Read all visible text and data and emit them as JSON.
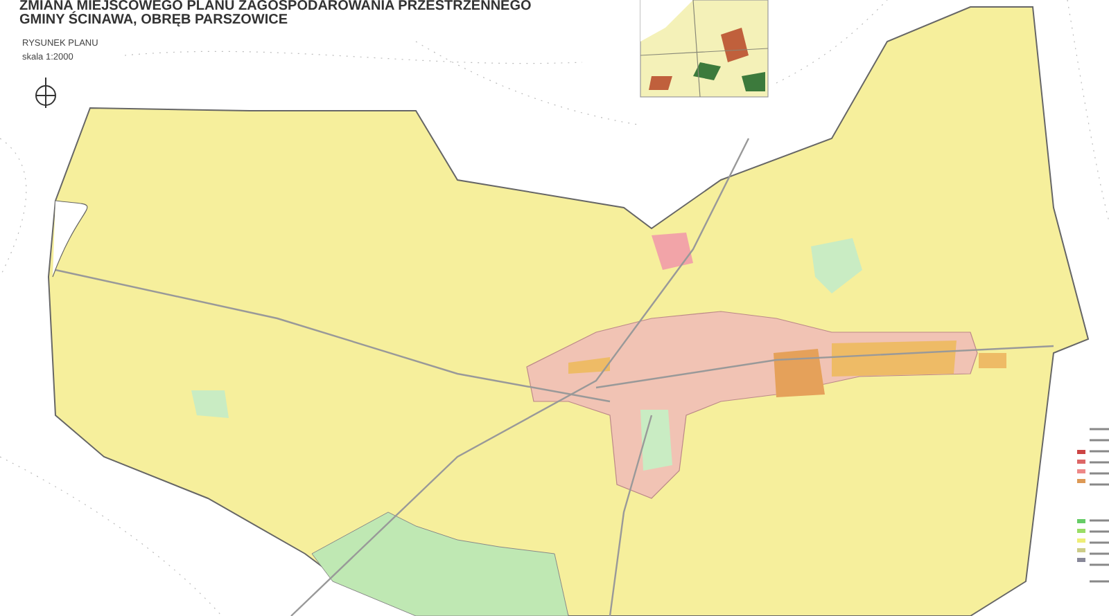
{
  "title_lines": [
    "ZMIANA MIEJSCOWEGO PLANU ZAGOSPODAROWANIA PRZESTRZENNEGO",
    "GMINY ŚCINAWA, OBRĘB PARSZOWICE"
  ],
  "drawing_label": "RYSUNEK PLANU",
  "scale": "skala 1:2000"
}
